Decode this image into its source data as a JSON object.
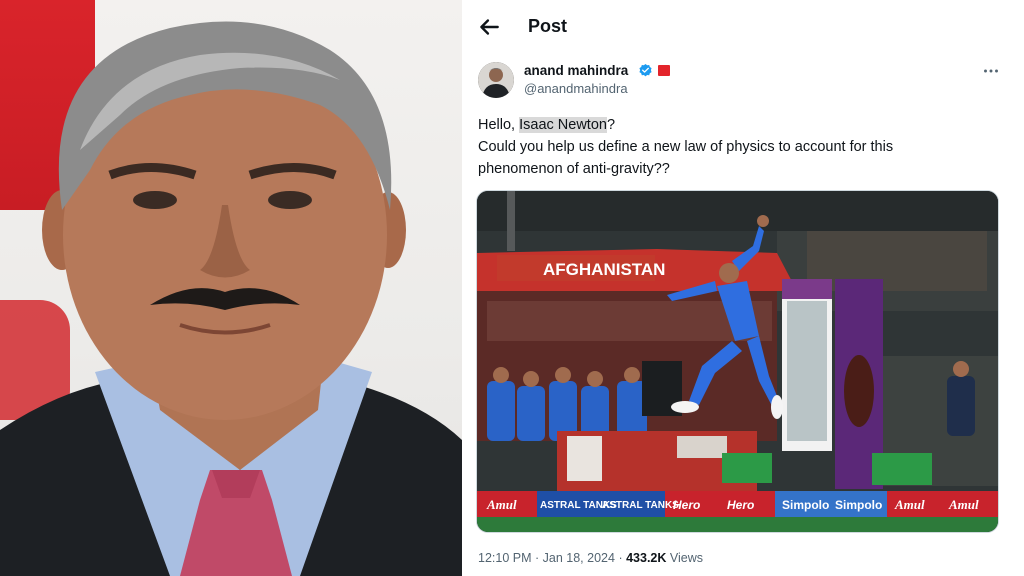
{
  "post": {
    "header_title": "Post",
    "author": {
      "name": "anand mahindra",
      "handle": "@anandmahindra"
    },
    "text": {
      "line1_prefix": "Hello, ",
      "line1_highlight": "Isaac Newton",
      "line1_suffix": "?",
      "line2": "Could you help us define a new law of physics to account for this",
      "line3": "phenomenon of anti-gravity??"
    },
    "media": {
      "dugout_sign": "AFGHANISTAN",
      "boards": [
        "Amul",
        "ASTRAL TANKS",
        "ASTRAL TANKS",
        "Hero",
        "Hero",
        "Simpolo",
        "Simpolo",
        "Amul",
        "Amul"
      ]
    },
    "meta": {
      "time": "12:10 PM",
      "date": "Jan 18, 2024",
      "views_count": "433.2K",
      "views_label": "Views",
      "separator": "·"
    }
  },
  "colors": {
    "verified": "#1d9bf0",
    "affiliate": "#e3242b",
    "text_secondary": "#536471",
    "board_red": "#c8232c",
    "board_blue": "#2e6fd0"
  }
}
